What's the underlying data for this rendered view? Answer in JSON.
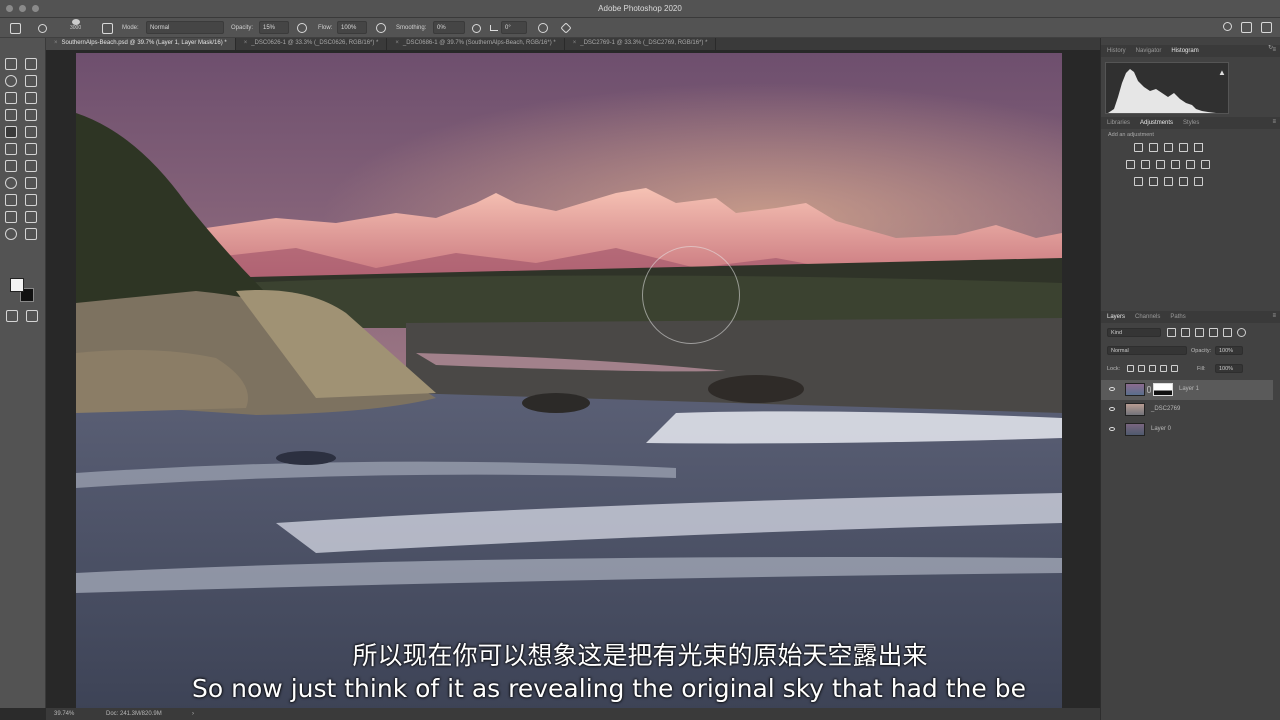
{
  "app": {
    "title": "Adobe Photoshop 2020"
  },
  "options_bar": {
    "brush_size": "3000",
    "mode_label": "Mode:",
    "mode_value": "Normal",
    "opacity_label": "Opacity:",
    "opacity_value": "15%",
    "flow_label": "Flow:",
    "flow_value": "100%",
    "smoothing_label": "Smoothing:",
    "smoothing_value": "0%",
    "angle_value": "0°"
  },
  "tabs": [
    {
      "label": "SouthernAlps-Beach.psd @ 39.7% (Layer 1, Layer Mask/16) *",
      "active": true
    },
    {
      "label": "_DSC0626-1 @ 33.3% (_DSC0626, RGB/16*) *",
      "active": false
    },
    {
      "label": "_DSC0686-1 @ 39.7% (SouthernAlps-Beach, RGB/16*) *",
      "active": false
    },
    {
      "label": "_DSC2769-1 @ 33.3% (_DSC2769, RGB/16*) *",
      "active": false
    }
  ],
  "status": {
    "zoom": "39.74%",
    "doc": "Doc: 241.3M/820.9M"
  },
  "panels": {
    "top_tabs": [
      "History",
      "Navigator",
      "Histogram"
    ],
    "mid_tabs": [
      "Libraries",
      "Adjustments",
      "Styles"
    ],
    "add_adjustment": "Add an adjustment",
    "layer_tabs": [
      "Layers",
      "Channels",
      "Paths"
    ],
    "kind_label": "Kind",
    "blend_mode": "Normal",
    "opacity_label": "Opacity:",
    "opacity_value": "100%",
    "lock_label": "Lock:",
    "fill_label": "Fill:",
    "fill_value": "100%",
    "layers": [
      {
        "name": "Layer 1",
        "selected": true,
        "mask": true
      },
      {
        "name": "_DSC2769",
        "selected": false,
        "mask": false
      },
      {
        "name": "Layer 0",
        "selected": false,
        "mask": false
      }
    ]
  },
  "subtitles": {
    "zh": "所以现在你可以想象这是把有光束的原始天空露出来",
    "en": "So now just think of it as revealing the original sky that had the be"
  },
  "colors": {
    "sky_top": "#7a5a7a",
    "sky_glow": "#b48a8a",
    "mountain_lit": "#f0a3a0",
    "water": "#46506a"
  }
}
